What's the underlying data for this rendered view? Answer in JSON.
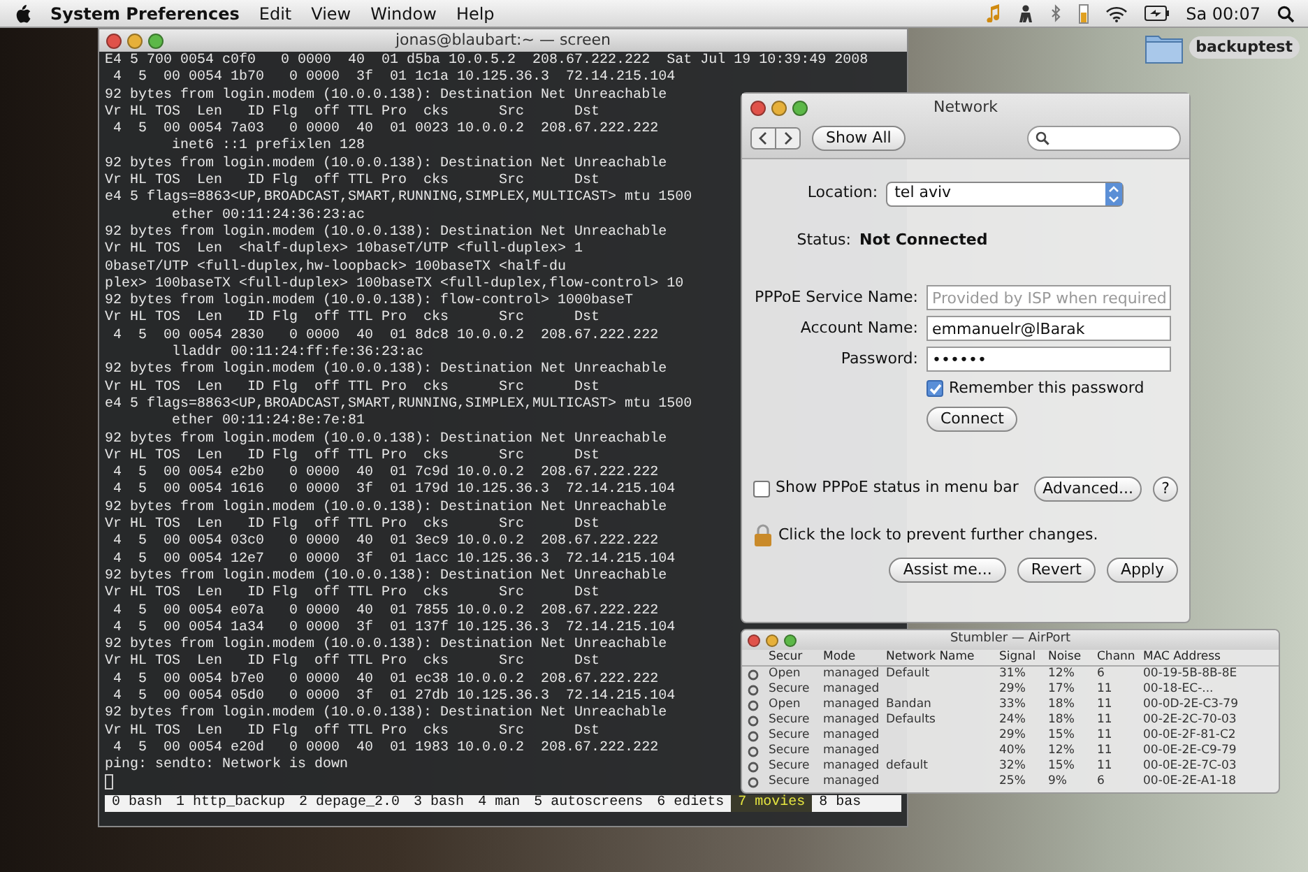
{
  "menu_bar": {
    "app": "System Preferences",
    "menus": [
      "Edit",
      "View",
      "Window",
      "Help"
    ],
    "clock": "Sa 00:07"
  },
  "desktop_icons": [
    {
      "label": "backuptest"
    }
  ],
  "terminal": {
    "title": "jonas@blaubart:~ — screen",
    "lines": [
      "E4 5 700 0054 c0f0   0 0000  40  01 d5ba 10.0.5.2  208.67.222.222  Sat Jul 19 10:39:49 2008",
      " 4  5  00 0054 1b70   0 0000  3f  01 1c1a 10.125.36.3  72.14.215.104",
      "92 bytes from login.modem (10.0.0.138): Destination Net Unreachable",
      "Vr HL TOS  Len   ID Flg  off TTL Pro  cks      Src      Dst",
      " 4  5  00 0054 7a03   0 0000  40  01 0023 10.0.0.2  208.67.222.222",
      "        inet6 ::1 prefixlen 128",
      "92 bytes from login.modem (10.0.0.138): Destination Net Unreachable",
      "Vr HL TOS  Len   ID Flg  off TTL Pro  cks      Src      Dst",
      "e4 5 flags=8863<UP,BROADCAST,SMART,RUNNING,SIMPLEX,MULTICAST> mtu 1500",
      "        ether 00:11:24:36:23:ac",
      "92 bytes from login.modem (10.0.0.138): Destination Net Unreachable",
      "Vr HL TOS  Len  <half-duplex> 10baseT/UTP <full-duplex> 1",
      "0baseT/UTP <full-duplex,hw-loopback> 100baseTX <half-du",
      "plex> 100baseTX <full-duplex> 100baseTX <full-duplex,flow-control> 10",
      "92 bytes from login.modem (10.0.0.138): flow-control> 1000baseT",
      "Vr HL TOS  Len   ID Flg  off TTL Pro  cks      Src      Dst",
      " 4  5  00 0054 2830   0 0000  40  01 8dc8 10.0.0.2  208.67.222.222",
      "        lladdr 00:11:24:ff:fe:36:23:ac",
      "92 bytes from login.modem (10.0.0.138): Destination Net Unreachable",
      "Vr HL TOS  Len   ID Flg  off TTL Pro  cks      Src      Dst",
      "e4 5 flags=8863<UP,BROADCAST,SMART,RUNNING,SIMPLEX,MULTICAST> mtu 1500",
      "        ether 00:11:24:8e:7e:81",
      "92 bytes from login.modem (10.0.0.138): Destination Net Unreachable",
      "Vr HL TOS  Len   ID Flg  off TTL Pro  cks      Src      Dst",
      " 4  5  00 0054 e2b0   0 0000  40  01 7c9d 10.0.0.2  208.67.222.222",
      " 4  5  00 0054 1616   0 0000  3f  01 179d 10.125.36.3  72.14.215.104",
      "92 bytes from login.modem (10.0.0.138): Destination Net Unreachable",
      "Vr HL TOS  Len   ID Flg  off TTL Pro  cks      Src      Dst",
      " 4  5  00 0054 03c0   0 0000  40  01 3ec9 10.0.0.2  208.67.222.222",
      " 4  5  00 0054 12e7   0 0000  3f  01 1acc 10.125.36.3  72.14.215.104",
      "92 bytes from login.modem (10.0.0.138): Destination Net Unreachable",
      "Vr HL TOS  Len   ID Flg  off TTL Pro  cks      Src      Dst",
      " 4  5  00 0054 e07a   0 0000  40  01 7855 10.0.0.2  208.67.222.222",
      " 4  5  00 0054 1a34   0 0000  3f  01 137f 10.125.36.3  72.14.215.104",
      "92 bytes from login.modem (10.0.0.138): Destination Net Unreachable",
      "Vr HL TOS  Len   ID Flg  off TTL Pro  cks      Src      Dst",
      " 4  5  00 0054 b7e0   0 0000  40  01 ec38 10.0.0.2  208.67.222.222",
      " 4  5  00 0054 05d0   0 0000  3f  01 27db 10.125.36.3  72.14.215.104",
      "92 bytes from login.modem (10.0.0.138): Destination Net Unreachable",
      "Vr HL TOS  Len   ID Flg  off TTL Pro  cks      Src      Dst",
      " 4  5  00 0054 e20d   0 0000  40  01 1983 10.0.0.2  208.67.222.222",
      "ping: sendto: Network is down"
    ],
    "screen_windows": [
      {
        "label": "0 bash",
        "selected": false
      },
      {
        "label": "1 http_backup",
        "selected": false
      },
      {
        "label": "2 depage_2.0",
        "selected": false
      },
      {
        "label": "3 bash",
        "selected": false
      },
      {
        "label": "4 man",
        "selected": false
      },
      {
        "label": "5 autoscreens",
        "selected": false
      },
      {
        "label": "6 ediets",
        "selected": false
      },
      {
        "label": "7 movies",
        "selected": true
      },
      {
        "label": "8 bas",
        "selected": false
      }
    ]
  },
  "network": {
    "title": "Network",
    "show_all": "Show All",
    "location_label": "Location:",
    "location": "tel aviv",
    "status_label": "Status:",
    "status": "Not Connected",
    "fields": [
      {
        "label": "PPPoE Service Name:",
        "placeholder": "Provided by ISP when required"
      },
      {
        "label": "Account Name:",
        "value": "emmanuelr@lBarak"
      },
      {
        "label": "Password:",
        "value": "••••••"
      }
    ],
    "remember": {
      "label": "Remember this password",
      "checked": true
    },
    "connect": "Connect",
    "show_status": {
      "label": "Show PPPoE status in menu bar",
      "checked": false
    },
    "advanced": "Advanced...",
    "help": "?",
    "lock_text": "Click the lock to prevent further changes.",
    "buttons": [
      "Assist me...",
      "Revert",
      "Apply"
    ]
  },
  "stumbler": {
    "title": "Stumbler — AirPort",
    "columns": [
      "Secur",
      "Mode",
      "Network Name",
      "Signal",
      "Noise",
      "Chann",
      "MAC Address"
    ],
    "rows": [
      [
        "Open",
        "managed",
        "Default",
        "31%",
        "12%",
        "6",
        "00-19-5B-8B-8E"
      ],
      [
        "Secure",
        "managed",
        "",
        "29%",
        "17%",
        "11",
        "00-18-EC-..."
      ],
      [
        "Open",
        "managed",
        "Bandan",
        "33%",
        "18%",
        "11",
        "00-0D-2E-C3-79"
      ],
      [
        "Secure",
        "managed",
        "Defaults",
        "24%",
        "18%",
        "11",
        "00-2E-2C-70-03"
      ],
      [
        "Secure",
        "managed",
        "",
        "29%",
        "15%",
        "11",
        "00-0E-2F-81-C2"
      ],
      [
        "Secure",
        "managed",
        "",
        "40%",
        "12%",
        "11",
        "00-0E-2E-C9-79"
      ],
      [
        "Secure",
        "managed",
        "default",
        "32%",
        "15%",
        "11",
        "00-0E-2E-7C-03"
      ],
      [
        "Secure",
        "managed",
        "",
        "25%",
        "9%",
        "6",
        "00-0E-2E-A1-18"
      ]
    ]
  }
}
